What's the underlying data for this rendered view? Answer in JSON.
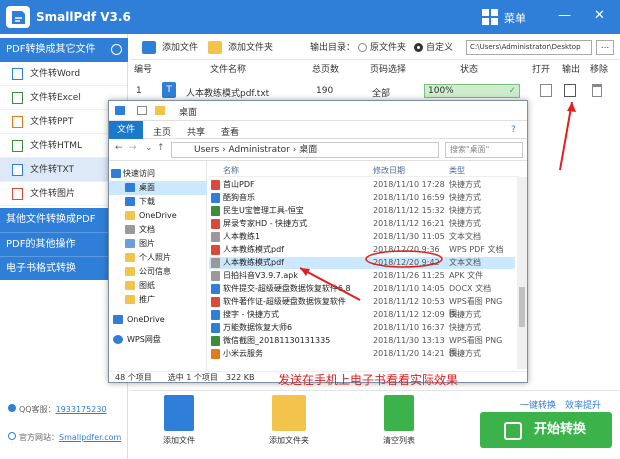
{
  "app": {
    "title": "SmallPdf V3.6",
    "menu_label": "菜单",
    "minimize_glyph": "—",
    "close_glyph": "✕"
  },
  "sidebar": {
    "sections": [
      "PDF转换成其它文件",
      "其他文件转换成PDF",
      "PDF的其他操作",
      "电子书格式转换"
    ],
    "items": [
      "文件转Word",
      "文件转Excel",
      "文件转PPT",
      "文件转HTML",
      "文件转TXT",
      "文件转图片"
    ],
    "active_item": "文件转TXT",
    "qq_label": "QQ客服：",
    "qq_number": "1933175230",
    "site_label": "官方网站：",
    "site_url": "Smallpdfer.com"
  },
  "toolbar": {
    "add_file": "添加文件",
    "add_folder": "添加文件夹",
    "output_label": "输出目录：",
    "radio_original": "原文件夹",
    "radio_custom": "自定义",
    "output_path": "C:\\Users\\Administrator\\Desktop",
    "browse": "..."
  },
  "table": {
    "headers": [
      "编号",
      "文件名称",
      "总页数",
      "页码选择",
      "状态",
      "打开",
      "输出",
      "移除"
    ],
    "rows": [
      {
        "index": "1",
        "icon_letter": "T",
        "name": "人本教练模式pdf.txt",
        "pages": "190",
        "page_select": "全部",
        "status": "100%"
      }
    ]
  },
  "explorer": {
    "title": "桌面",
    "tabs": [
      "文件",
      "主页",
      "共享",
      "查看"
    ],
    "address": "Users › Administrator › 桌面",
    "search_placeholder": "搜索\"桌面\"",
    "nav": [
      "快速访问",
      "桌面",
      "下载",
      "OneDrive",
      "文档",
      "图片",
      "个人照片",
      "公司信息",
      "图纸",
      "推广",
      "OneDrive",
      "WPS网盘"
    ],
    "columns": [
      "名称",
      "修改日期",
      "类型"
    ],
    "files": [
      {
        "name": "首山PDF",
        "date": "2018/11/10 17:28",
        "type": "快捷方式",
        "color": "#d94a3a"
      },
      {
        "name": "酷狗音乐",
        "date": "2018/11/10 16:59",
        "type": "快捷方式",
        "color": "#2f7fd9"
      },
      {
        "name": "民生U宝管理工具-恒宝",
        "date": "2018/11/12 15:32",
        "type": "快捷方式",
        "color": "#3b8d3b"
      },
      {
        "name": "屏录专家HD - 快捷方式",
        "date": "2018/11/12 16:21",
        "type": "快捷方式",
        "color": "#d94a3a"
      },
      {
        "name": "人本教练1",
        "date": "2018/11/30 11:05",
        "type": "文本文档",
        "color": "#999999"
      },
      {
        "name": "人本教练模式pdf",
        "date": "2018/12/20 9:36",
        "type": "WPS PDF 文档",
        "color": "#d94a3a"
      },
      {
        "name": "人本教练模式pdf",
        "date": "2018/12/20 9:42",
        "type": "文本文档",
        "color": "#999999"
      },
      {
        "name": "日拍抖音V3.9.7.apk",
        "date": "2018/11/26 11:25",
        "type": "APK 文件",
        "color": "#9a9a9a"
      },
      {
        "name": "软件提交-超级硬盘数据恢复软件6.8",
        "date": "2018/11/10 14:05",
        "type": "DOCX 文档",
        "color": "#2f7fd9"
      },
      {
        "name": "软件著作证-超级硬盘数据恢复软件",
        "date": "2018/11/12 10:53",
        "type": "WPS看图 PNG 图...",
        "color": "#d94a3a"
      },
      {
        "name": "搜字 - 快捷方式",
        "date": "2018/11/12 12:09",
        "type": "快捷方式",
        "color": "#2f7fd9"
      },
      {
        "name": "万能数据恢复大师6",
        "date": "2018/11/10 16:37",
        "type": "快捷方式",
        "color": "#2f7fd9"
      },
      {
        "name": "微信截图_20181130131335",
        "date": "2018/11/30 13:13",
        "type": "WPS看图 PNG 图...",
        "color": "#3b8d3b"
      },
      {
        "name": "小米云服务",
        "date": "2018/11/20 14:21",
        "type": "快捷方式",
        "color": "#e07a1a"
      }
    ],
    "selected_index": 6,
    "status": "48 个项目　　选中 1 个项目　322 KB"
  },
  "bottom": {
    "add_file": "添加文件",
    "add_folder": "添加文件夹",
    "clear_list": "清空列表",
    "links": "一键转换　效率提升",
    "start": "开始转换"
  },
  "annotation": "发送在手机上电子书看看实际效果",
  "colors": {
    "primary": "#2f7fd9",
    "accent_green": "#3cb34a",
    "annotation_red": "#e02020"
  }
}
